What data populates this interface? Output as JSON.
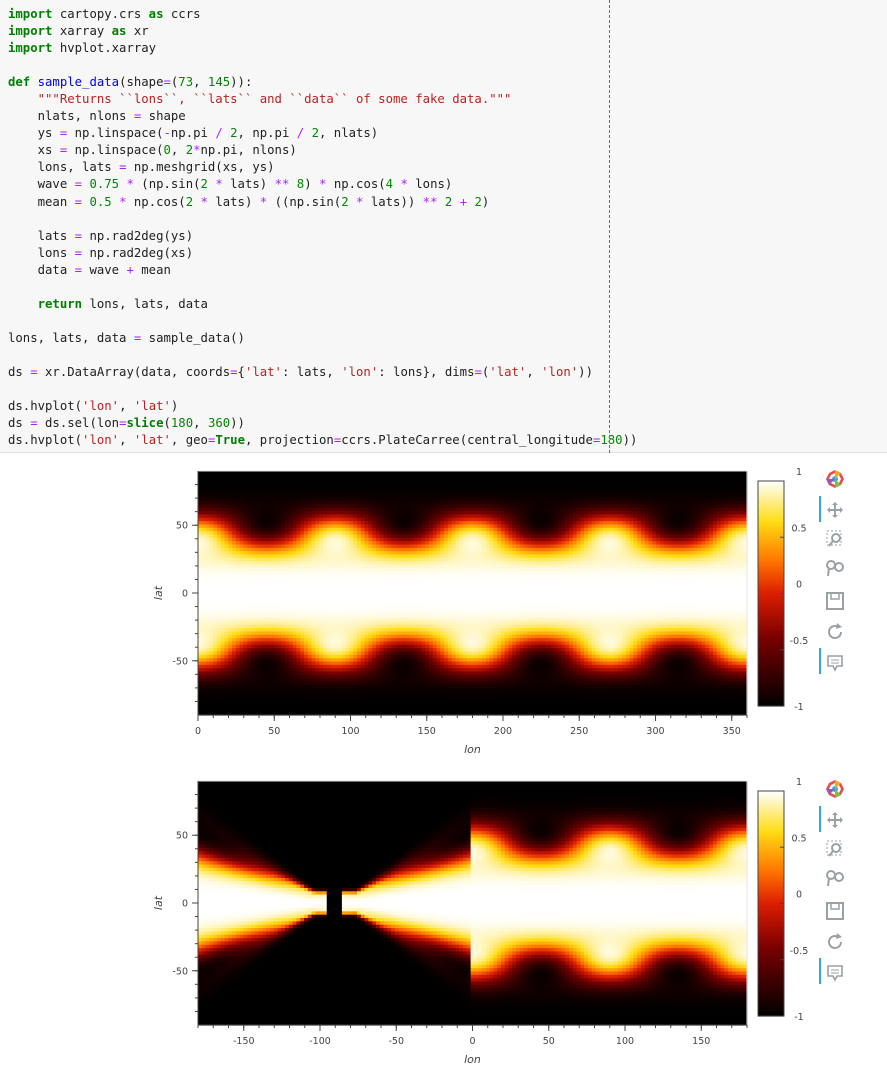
{
  "code": {
    "lines": [
      [
        [
          "kw",
          "import"
        ],
        [
          "pl",
          " cartopy.crs "
        ],
        [
          "kw",
          "as"
        ],
        [
          "pl",
          " ccrs"
        ]
      ],
      [
        [
          "kw",
          "import"
        ],
        [
          "pl",
          " xarray "
        ],
        [
          "kw",
          "as"
        ],
        [
          "pl",
          " xr"
        ]
      ],
      [
        [
          "kw",
          "import"
        ],
        [
          "pl",
          " hvplot.xarray"
        ]
      ],
      [],
      [
        [
          "kw",
          "def"
        ],
        [
          "pl",
          " "
        ],
        [
          "fn",
          "sample_data"
        ],
        [
          "pl",
          "(shape"
        ],
        [
          "op",
          "="
        ],
        [
          "pl",
          "("
        ],
        [
          "nm",
          "73"
        ],
        [
          "pl",
          ", "
        ],
        [
          "nm",
          "145"
        ],
        [
          "pl",
          "))"
        ],
        [
          "pl",
          ":"
        ]
      ],
      [
        [
          "pl",
          "    "
        ],
        [
          "st",
          "\"\"\"Returns ``lons``, ``lats`` and ``data`` of some fake data.\"\"\""
        ]
      ],
      [
        [
          "pl",
          "    nlats, nlons "
        ],
        [
          "op",
          "="
        ],
        [
          "pl",
          " shape"
        ]
      ],
      [
        [
          "pl",
          "    ys "
        ],
        [
          "op",
          "="
        ],
        [
          "pl",
          " np.linspace("
        ],
        [
          "op",
          "-"
        ],
        [
          "pl",
          "np.pi "
        ],
        [
          "op",
          "/"
        ],
        [
          "pl",
          " "
        ],
        [
          "nm",
          "2"
        ],
        [
          "pl",
          ", np.pi "
        ],
        [
          "op",
          "/"
        ],
        [
          "pl",
          " "
        ],
        [
          "nm",
          "2"
        ],
        [
          "pl",
          ", nlats)"
        ]
      ],
      [
        [
          "pl",
          "    xs "
        ],
        [
          "op",
          "="
        ],
        [
          "pl",
          " np.linspace("
        ],
        [
          "nm",
          "0"
        ],
        [
          "pl",
          ", "
        ],
        [
          "nm",
          "2"
        ],
        [
          "op",
          "*"
        ],
        [
          "pl",
          "np.pi, nlons)"
        ]
      ],
      [
        [
          "pl",
          "    lons, lats "
        ],
        [
          "op",
          "="
        ],
        [
          "pl",
          " np.meshgrid(xs, ys)"
        ]
      ],
      [
        [
          "pl",
          "    wave "
        ],
        [
          "op",
          "="
        ],
        [
          "pl",
          " "
        ],
        [
          "nm",
          "0.75"
        ],
        [
          "pl",
          " "
        ],
        [
          "op",
          "*"
        ],
        [
          "pl",
          " (np.sin("
        ],
        [
          "nm",
          "2"
        ],
        [
          "pl",
          " "
        ],
        [
          "op",
          "*"
        ],
        [
          "pl",
          " lats) "
        ],
        [
          "op",
          "**"
        ],
        [
          "pl",
          " "
        ],
        [
          "nm",
          "8"
        ],
        [
          "pl",
          ") "
        ],
        [
          "op",
          "*"
        ],
        [
          "pl",
          " np.cos("
        ],
        [
          "nm",
          "4"
        ],
        [
          "pl",
          " "
        ],
        [
          "op",
          "*"
        ],
        [
          "pl",
          " lons)"
        ]
      ],
      [
        [
          "pl",
          "    mean "
        ],
        [
          "op",
          "="
        ],
        [
          "pl",
          " "
        ],
        [
          "nm",
          "0.5"
        ],
        [
          "pl",
          " "
        ],
        [
          "op",
          "*"
        ],
        [
          "pl",
          " np.cos("
        ],
        [
          "nm",
          "2"
        ],
        [
          "pl",
          " "
        ],
        [
          "op",
          "*"
        ],
        [
          "pl",
          " lats) "
        ],
        [
          "op",
          "*"
        ],
        [
          "pl",
          " ((np.sin("
        ],
        [
          "nm",
          "2"
        ],
        [
          "pl",
          " "
        ],
        [
          "op",
          "*"
        ],
        [
          "pl",
          " lats)) "
        ],
        [
          "op",
          "**"
        ],
        [
          "pl",
          " "
        ],
        [
          "nm",
          "2"
        ],
        [
          "pl",
          " "
        ],
        [
          "op",
          "+"
        ],
        [
          "pl",
          " "
        ],
        [
          "nm",
          "2"
        ],
        [
          "pl",
          ")"
        ]
      ],
      [],
      [
        [
          "pl",
          "    lats "
        ],
        [
          "op",
          "="
        ],
        [
          "pl",
          " np.rad2deg(ys)"
        ]
      ],
      [
        [
          "pl",
          "    lons "
        ],
        [
          "op",
          "="
        ],
        [
          "pl",
          " np.rad2deg(xs)"
        ]
      ],
      [
        [
          "pl",
          "    data "
        ],
        [
          "op",
          "="
        ],
        [
          "pl",
          " wave "
        ],
        [
          "op",
          "+"
        ],
        [
          "pl",
          " mean"
        ]
      ],
      [],
      [
        [
          "pl",
          "    "
        ],
        [
          "kw",
          "return"
        ],
        [
          "pl",
          " lons, lats, data"
        ]
      ],
      [],
      [
        [
          "pl",
          "lons, lats, data "
        ],
        [
          "op",
          "="
        ],
        [
          "pl",
          " sample_data()"
        ]
      ],
      [],
      [
        [
          "pl",
          "ds "
        ],
        [
          "op",
          "="
        ],
        [
          "pl",
          " xr.DataArray(data, coords"
        ],
        [
          "op",
          "="
        ],
        [
          "pl",
          "{"
        ],
        [
          "st",
          "'lat'"
        ],
        [
          "pl",
          ": lats, "
        ],
        [
          "st",
          "'lon'"
        ],
        [
          "pl",
          ": lons}, dims"
        ],
        [
          "op",
          "="
        ],
        [
          "pl",
          "("
        ],
        [
          "st",
          "'lat'"
        ],
        [
          "pl",
          ", "
        ],
        [
          "st",
          "'lon'"
        ],
        [
          "pl",
          "))"
        ]
      ],
      [],
      [
        [
          "pl",
          "ds.hvplot("
        ],
        [
          "st",
          "'lon'"
        ],
        [
          "pl",
          ", "
        ],
        [
          "st",
          "'lat'"
        ],
        [
          "pl",
          ")"
        ]
      ],
      [
        [
          "pl",
          "ds "
        ],
        [
          "op",
          "="
        ],
        [
          "pl",
          " ds.sel(lon"
        ],
        [
          "op",
          "="
        ],
        [
          "kw",
          "slice"
        ],
        [
          "pl",
          "("
        ],
        [
          "nm",
          "180"
        ],
        [
          "pl",
          ", "
        ],
        [
          "nm",
          "360"
        ],
        [
          "pl",
          "))"
        ]
      ],
      [
        [
          "pl",
          "ds.hvplot("
        ],
        [
          "st",
          "'lon'"
        ],
        [
          "pl",
          ", "
        ],
        [
          "st",
          "'lat'"
        ],
        [
          "pl",
          ", geo"
        ],
        [
          "op",
          "="
        ],
        [
          "kw",
          "True"
        ],
        [
          "pl",
          ", projection"
        ],
        [
          "op",
          "="
        ],
        [
          "pl",
          "ccrs.PlateCarree(central_longitude"
        ],
        [
          "op",
          "="
        ],
        [
          "nm",
          "180"
        ],
        [
          "pl",
          "))"
        ]
      ]
    ]
  },
  "colors": {
    "code_bg": "#f7f7f7",
    "keyword": "#008000",
    "function": "#0000ff",
    "string": "#ba2121",
    "number": "#008800",
    "operator": "#aa22ff",
    "ruler": "#e23b3b",
    "toolbar_active": "#26aae1",
    "colormap": "fire (black-red-yellow-white)"
  },
  "toolbar": {
    "tools": [
      "bokeh-logo-icon",
      "pan-icon",
      "box-zoom-icon",
      "wheel-zoom-icon",
      "save-icon",
      "reset-icon",
      "hover-icon"
    ]
  },
  "chart_data": [
    {
      "type": "heatmap",
      "title": "",
      "xlabel": "lon",
      "ylabel": "lat",
      "xlim": [
        0,
        360
      ],
      "ylim": [
        -90,
        90
      ],
      "x_ticks": [
        "0",
        "50",
        "100",
        "150",
        "200",
        "250",
        "300",
        "350"
      ],
      "y_ticks": [
        "50",
        "0",
        "-50"
      ],
      "colorbar_ticks": [
        "1",
        "0.5",
        "0",
        "-0.5",
        "-1"
      ],
      "colorbar_range": [
        -1,
        1
      ],
      "grid": {
        "nlat": 73,
        "nlon": 145
      },
      "formula": "data = 0.75*sin(2*lat)^8*cos(4*lon) + 0.5*cos(2*lat)*(sin(2*lat)^2 + 2)",
      "projection": "none"
    },
    {
      "type": "heatmap",
      "title": "",
      "xlabel": "lon",
      "ylabel": "lat",
      "xlim": [
        -180,
        180
      ],
      "ylim": [
        -90,
        90
      ],
      "x_ticks": [
        "-150",
        "-100",
        "-50",
        "0",
        "50",
        "100",
        "150"
      ],
      "y_ticks": [
        "50",
        "0",
        "-50"
      ],
      "colorbar_ticks": [
        "1",
        "0.5",
        "0",
        "-0.5",
        "-1"
      ],
      "colorbar_range": [
        -1,
        1
      ],
      "grid": {
        "nlat": 73,
        "nlon": 145
      },
      "formula": "same data, lon selected 180..360, PlateCarree(central_longitude=180)",
      "projection": "PlateCarree(central_longitude=180)"
    }
  ]
}
